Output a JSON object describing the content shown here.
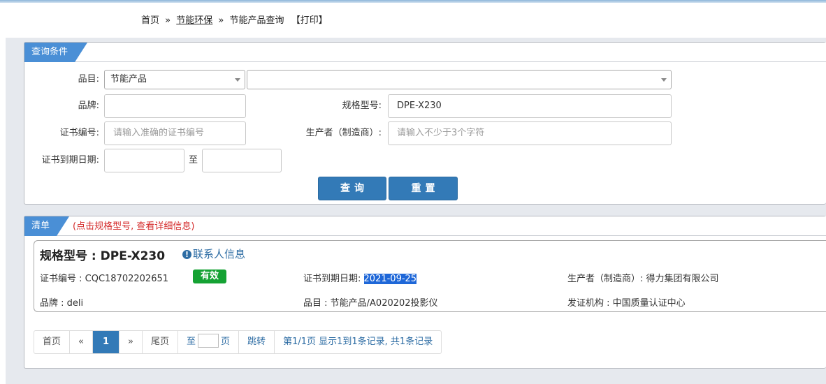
{
  "breadcrumb": {
    "home": "首页",
    "sep1": "»",
    "category": "节能环保",
    "sep2": "»",
    "current": "节能产品查询",
    "print": "【打印】"
  },
  "query_panel": {
    "title": "查询条件",
    "category_label": "品目:",
    "category_value": "节能产品",
    "subcategory_value": "",
    "brand_label": "品牌:",
    "brand_value": "",
    "spec_label": "规格型号:",
    "spec_value": "DPE-X230",
    "cert_no_label": "证书编号:",
    "cert_no_placeholder": "请输入准确的证书编号",
    "maker_label": "生产者（制造商）:",
    "maker_placeholder": "请输入不少于3个字符",
    "expiry_label": "证书到期日期:",
    "expiry_from": "",
    "expiry_to_label": "至",
    "expiry_to": "",
    "search_button": "查询",
    "reset_button": "重置"
  },
  "list_panel": {
    "title": "清单",
    "note": "(点击规格型号, 查看详细信息)"
  },
  "result": {
    "spec_title": "规格型号 : DPE-X230",
    "contact_icon": "exclamation-circle-icon",
    "contact_label": "联系人信息",
    "cert_no": "证书编号 : CQC18702202651",
    "status_badge": "有效",
    "expiry_label": "证书到期日期:",
    "expiry_value": "2021-09-25",
    "maker": "生产者（制造商）: 得力集团有限公司",
    "brand": "品牌 : deli",
    "category": "品目 : 节能产品/A020202投影仪",
    "issuer": "发证机构 : 中国质量认证中心"
  },
  "pagination": {
    "first": "首页",
    "prev": "«",
    "current": "1",
    "next": "»",
    "last": "尾页",
    "goto_to": "至",
    "goto_page": "页",
    "jump": "跳转",
    "summary": "第1/1页  显示1到1条记录, 共1条记录"
  },
  "colors": {
    "accent": "#337ab7",
    "panel_tab": "#4a8fd6",
    "valid_badge": "#15a233",
    "note_red": "#d42b2b"
  }
}
